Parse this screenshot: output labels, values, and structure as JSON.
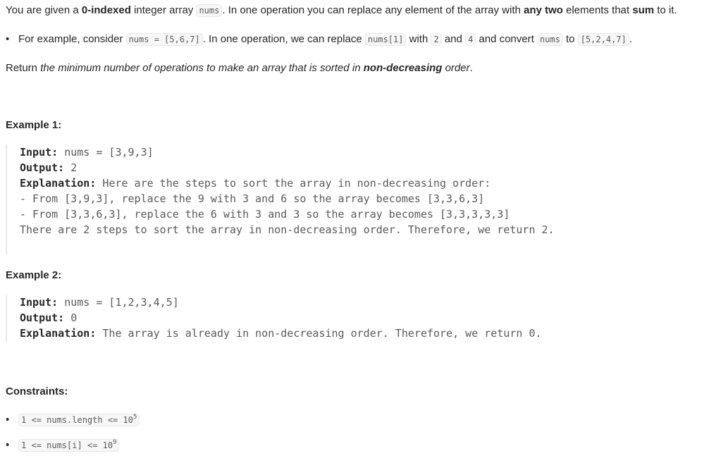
{
  "intro": {
    "t1": "You are given a ",
    "b1": "0-indexed",
    "t2": " integer array ",
    "c1": "nums",
    "t3": ". In one operation you can replace any element of the array with ",
    "b2": "any two",
    "t4": " elements that ",
    "b3": "sum",
    "t5": " to it."
  },
  "example_bullet": {
    "t1": "For example, consider ",
    "c1": "nums = [5,6,7]",
    "t2": ". In one operation, we can replace ",
    "c2": "nums[1]",
    "t3": " with ",
    "c3": "2",
    "t4": " and ",
    "c4": "4",
    "t5": " and convert ",
    "c5": "nums",
    "t6": " to ",
    "c6": "[5,2,4,7]",
    "t7": "."
  },
  "return_text": {
    "t1": "Return ",
    "i1": "the minimum number of operations to make an array that is sorted in ",
    "b1": "non-decreasing",
    "i2": " order",
    "t2": "."
  },
  "examples": [
    {
      "heading": "Example 1:",
      "input_label": "Input:",
      "input_value": " nums = [3,9,3]",
      "output_label": "Output:",
      "output_value": " 2",
      "explanation_label": "Explanation:",
      "explanation_lines": [
        " Here are the steps to sort the array in non-decreasing order:",
        "- From [3,9,3], replace the 9 with 3 and 6 so the array becomes [3,3,6,3]",
        "- From [3,3,6,3], replace the 6 with 3 and 3 so the array becomes [3,3,3,3,3]",
        "There are 2 steps to sort the array in non-decreasing order. Therefore, we return 2."
      ]
    },
    {
      "heading": "Example 2:",
      "input_label": "Input:",
      "input_value": " nums = [1,2,3,4,5]",
      "output_label": "Output:",
      "output_value": " 0",
      "explanation_label": "Explanation:",
      "explanation_lines": [
        " The array is already in non-decreasing order. Therefore, we return 0."
      ]
    }
  ],
  "constraints": {
    "heading": "Constraints:",
    "items": [
      {
        "base": "1 <= nums.length <= 10",
        "sup": "5"
      },
      {
        "base": "1 <= nums[i] <= 10",
        "sup": "9"
      }
    ]
  }
}
